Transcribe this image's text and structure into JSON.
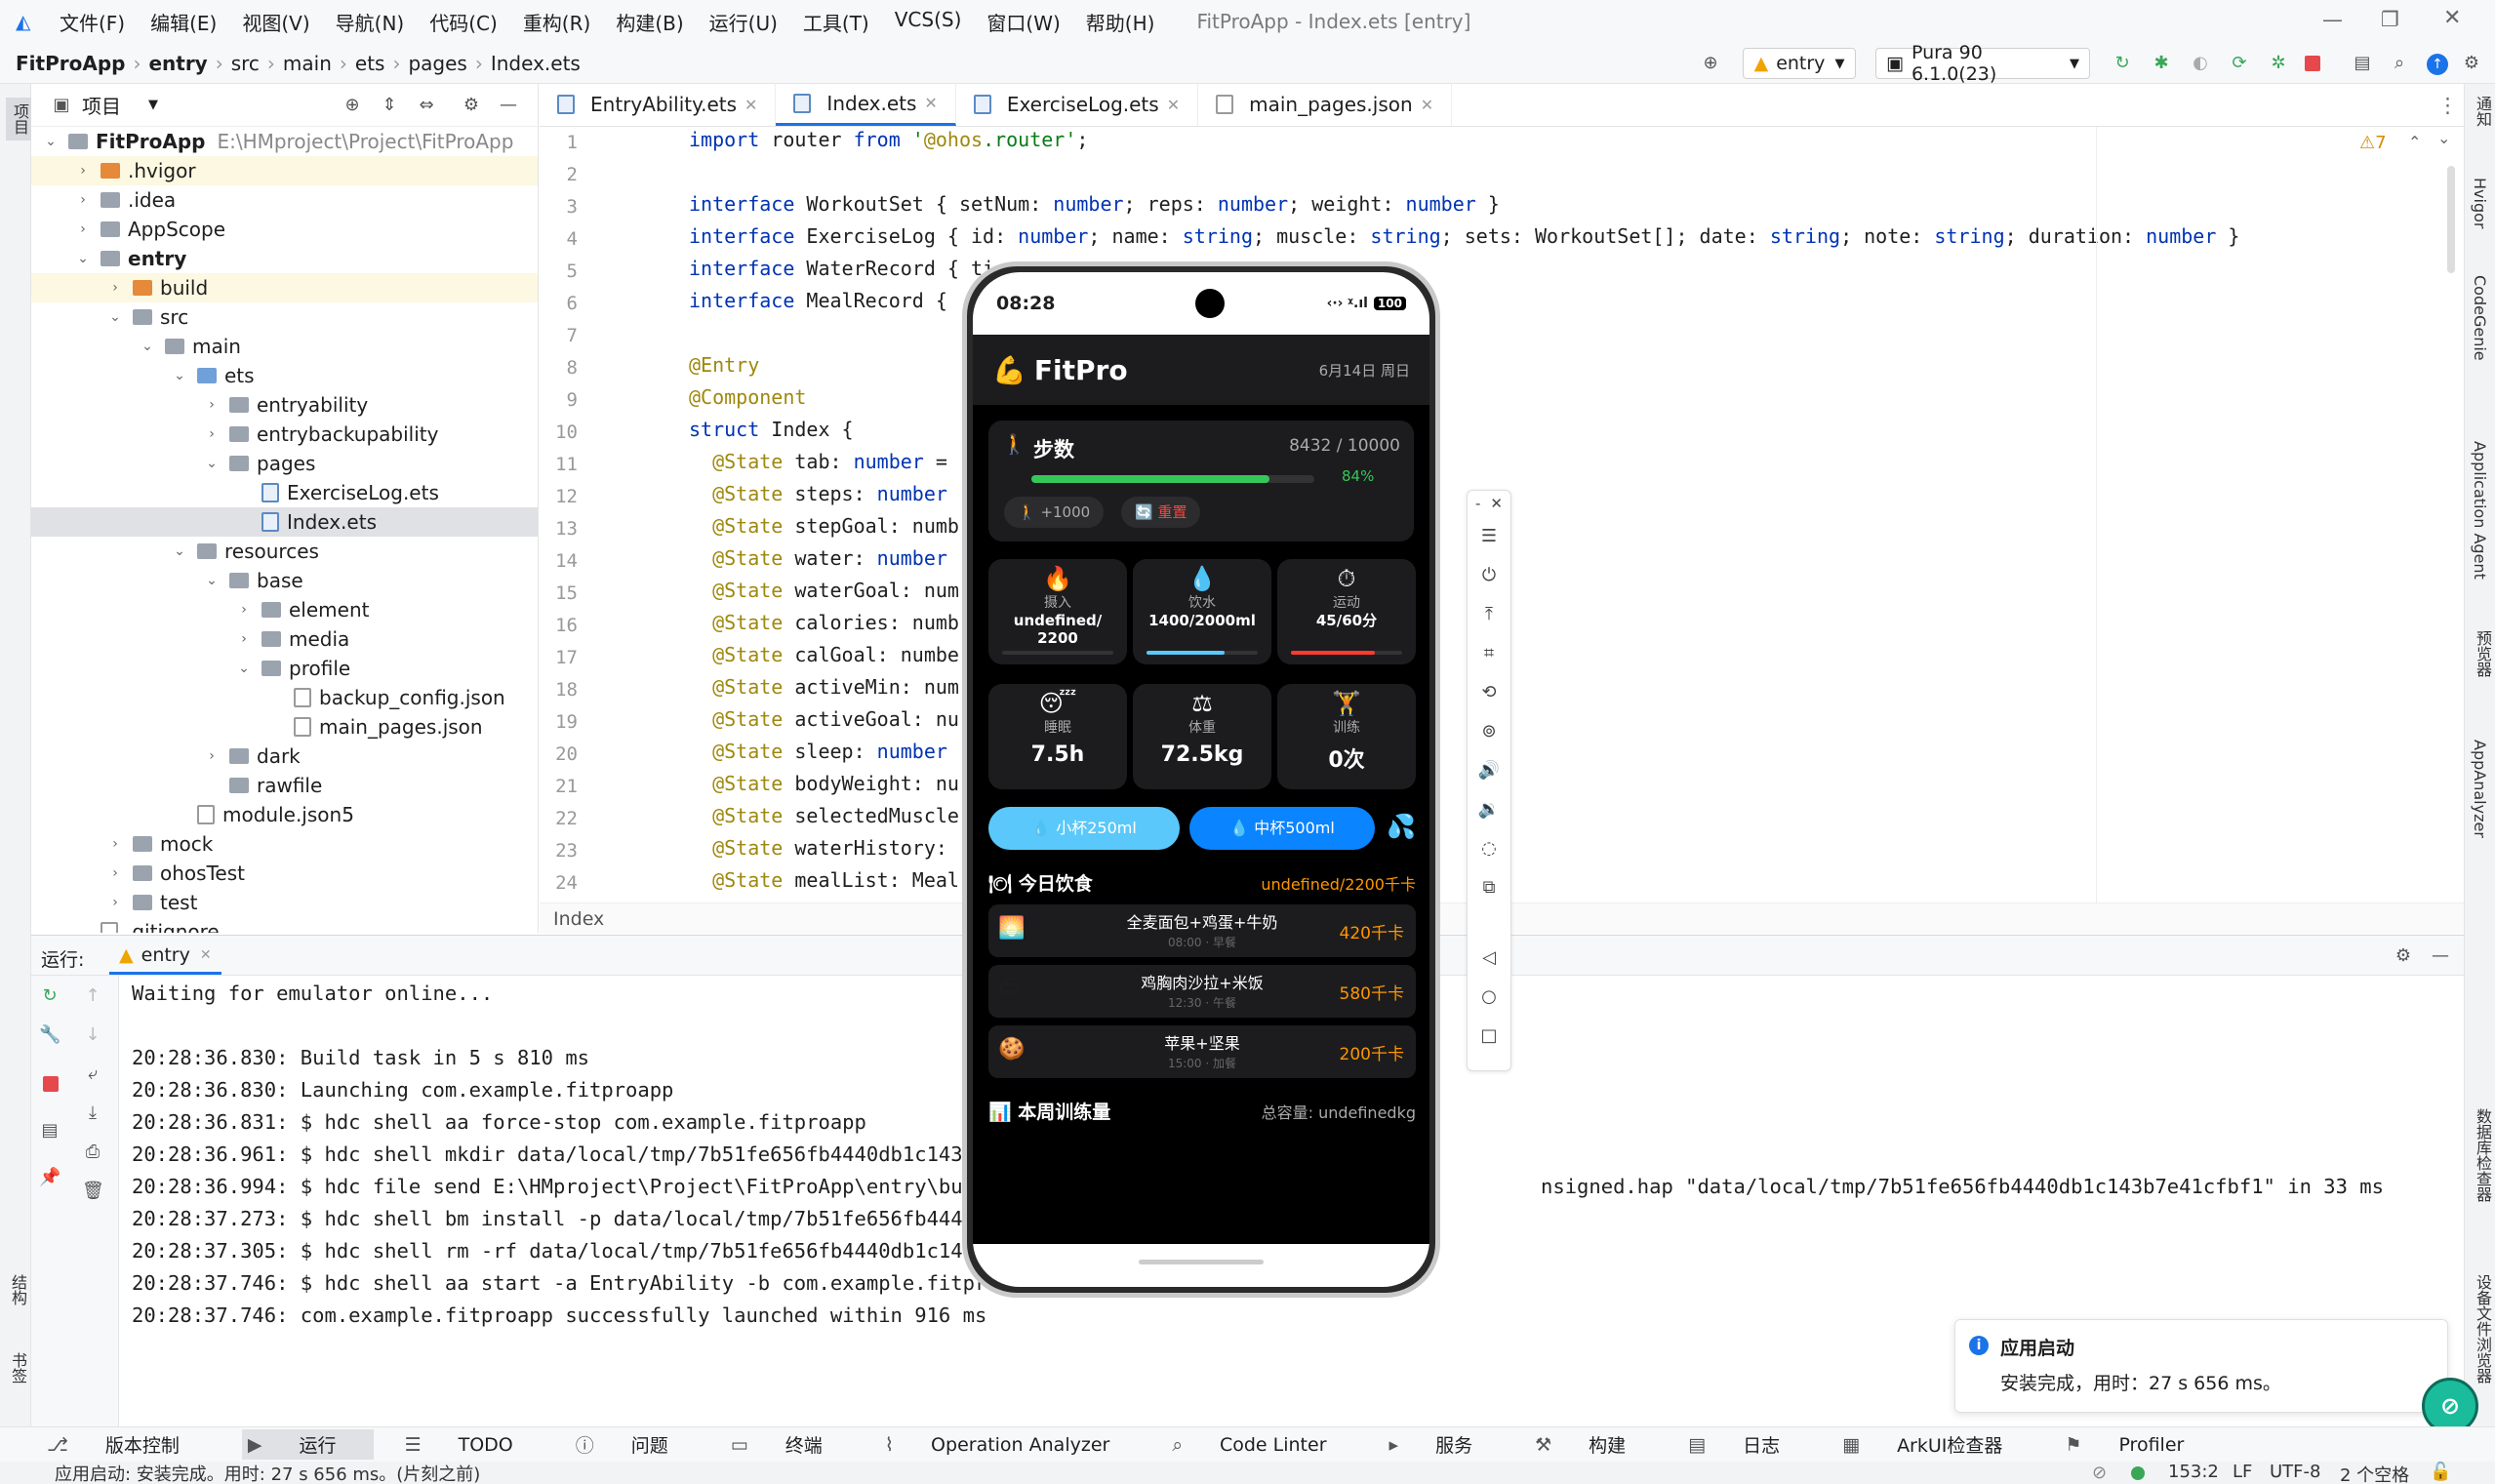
{
  "menu": [
    "文件(F)",
    "编辑(E)",
    "视图(V)",
    "导航(N)",
    "代码(C)",
    "重构(R)",
    "构建(B)",
    "运行(U)",
    "工具(T)",
    "VCS(S)",
    "窗口(W)",
    "帮助(H)"
  ],
  "window_title": "FitProApp - Index.ets [entry]",
  "breadcrumb": [
    "FitProApp",
    "entry",
    "src",
    "main",
    "ets",
    "pages",
    "Index.ets"
  ],
  "run_config": "entry",
  "device": "Pura 90 6.1.0(23)",
  "project_panel": {
    "title": "项目"
  },
  "tree": [
    {
      "depth": 0,
      "label": "FitProApp",
      "path": "E:\\HMproject\\Project\\FitProApp",
      "type": "root",
      "arrow": "v"
    },
    {
      "depth": 1,
      "label": ".hvigor",
      "type": "folder-orange",
      "arrow": ">",
      "hl": true
    },
    {
      "depth": 1,
      "label": ".idea",
      "type": "folder",
      "arrow": ">"
    },
    {
      "depth": 1,
      "label": "AppScope",
      "type": "folder",
      "arrow": ">"
    },
    {
      "depth": 1,
      "label": "entry",
      "type": "folder",
      "arrow": "v",
      "bold": true
    },
    {
      "depth": 2,
      "label": "build",
      "type": "folder-orange",
      "arrow": ">",
      "hl": true
    },
    {
      "depth": 2,
      "label": "src",
      "type": "folder",
      "arrow": "v"
    },
    {
      "depth": 3,
      "label": "main",
      "type": "folder",
      "arrow": "v"
    },
    {
      "depth": 4,
      "label": "ets",
      "type": "folder-blue",
      "arrow": "v"
    },
    {
      "depth": 5,
      "label": "entryability",
      "type": "folder",
      "arrow": ">"
    },
    {
      "depth": 5,
      "label": "entrybackupability",
      "type": "folder",
      "arrow": ">"
    },
    {
      "depth": 5,
      "label": "pages",
      "type": "folder",
      "arrow": "v"
    },
    {
      "depth": 6,
      "label": "ExerciseLog.ets",
      "type": "file",
      "arrow": ""
    },
    {
      "depth": 6,
      "label": "Index.ets",
      "type": "file",
      "arrow": "",
      "sel": true
    },
    {
      "depth": 4,
      "label": "resources",
      "type": "folder",
      "arrow": "v"
    },
    {
      "depth": 5,
      "label": "base",
      "type": "folder",
      "arrow": "v"
    },
    {
      "depth": 6,
      "label": "element",
      "type": "folder",
      "arrow": ">"
    },
    {
      "depth": 6,
      "label": "media",
      "type": "folder",
      "arrow": ">"
    },
    {
      "depth": 6,
      "label": "profile",
      "type": "folder",
      "arrow": "v"
    },
    {
      "depth": 7,
      "label": "backup_config.json",
      "type": "json",
      "arrow": ""
    },
    {
      "depth": 7,
      "label": "main_pages.json",
      "type": "json",
      "arrow": ""
    },
    {
      "depth": 5,
      "label": "dark",
      "type": "folder",
      "arrow": ">"
    },
    {
      "depth": 5,
      "label": "rawfile",
      "type": "folder",
      "arrow": ""
    },
    {
      "depth": 4,
      "label": "module.json5",
      "type": "json",
      "arrow": ""
    },
    {
      "depth": 2,
      "label": "mock",
      "type": "folder",
      "arrow": ">"
    },
    {
      "depth": 2,
      "label": "ohosTest",
      "type": "folder",
      "arrow": ">"
    },
    {
      "depth": 2,
      "label": "test",
      "type": "folder",
      "arrow": ">"
    },
    {
      "depth": 1,
      "label": ".gitignore",
      "type": "json",
      "arrow": ""
    }
  ],
  "tabs": [
    {
      "label": "EntryAbility.ets",
      "active": false
    },
    {
      "label": "Index.ets",
      "active": true
    },
    {
      "label": "ExerciseLog.ets",
      "active": false
    },
    {
      "label": "main_pages.json",
      "active": false
    }
  ],
  "warnings": "⚠7",
  "code_lines": [
    "import router from '@ohos.router';",
    "",
    "interface WorkoutSet { setNum: number; reps: number; weight: number }",
    "interface ExerciseLog { id: number; name: string; muscle: string; sets: WorkoutSet[]; date: string; note: string; duration: number }",
    "interface WaterRecord { ti",
    "interface MealRecord {                          type: string }",
    "",
    "@Entry",
    "@Component",
    "struct Index {",
    "  @State tab: number = ",
    "  @State steps: number",
    "  @State stepGoal: numb",
    "  @State water: number",
    "  @State waterGoal: num",
    "  @State calories: numb",
    "  @State calGoal: numbe",
    "  @State activeMin: num",
    "  @State activeGoal: nu",
    "  @State sleep: number ",
    "  @State bodyWeight: nu",
    "  @State selectedMuscle",
    "  @State waterHistory: ",
    "  @State mealList: Meal"
  ],
  "editor_crumb": "Index",
  "run_panel": {
    "label": "运行:",
    "config": "entry"
  },
  "console_lines": [
    "Waiting for emulator online...",
    "",
    "20:28:36.830: Build task in 5 s 810 ms",
    "20:28:36.830: Launching com.example.fitproapp",
    "20:28:36.831: $ hdc shell aa force-stop com.example.fitproapp",
    "20:28:36.961: $ hdc shell mkdir data/local/tmp/7b51fe656fb4440db1c143b7",
    "20:28:36.994: $ hdc file send E:\\HMproject\\Project\\FitProApp\\entry\\buil                                              nsigned.hap \"data/local/tmp/7b51fe656fb4440db1c143b7e41cfbf1\" in 33 ms",
    "20:28:37.273: $ hdc shell bm install -p data/local/tmp/7b51fe656fb4440c",
    "20:28:37.305: $ hdc shell rm -rf data/local/tmp/7b51fe656fb4440db1c143b",
    "20:28:37.746: $ hdc shell aa start -a EntryAbility -b com.example.fitpro",
    "20:28:37.746: com.example.fitproapp successfully launched within 916 ms"
  ],
  "bottom_tools": [
    "版本控制",
    "运行",
    "TODO",
    "问题",
    "终端",
    "Operation Analyzer",
    "Code Linter",
    "服务",
    "构建",
    "日志",
    "ArkUI检查器",
    "Profiler"
  ],
  "status": {
    "message": "应用启动: 安装完成。用时: 27 s 656 ms。(片刻之前)",
    "pos": "153:2",
    "eol": "LF",
    "enc": "UTF-8",
    "indent": "2 个空格"
  },
  "notification": {
    "title": "应用启动",
    "body": "安装完成，用时：27 s 656 ms。"
  },
  "left_strip": [
    "项目",
    "结构",
    "书签"
  ],
  "right_strip": [
    "通知",
    "Hvigor",
    "CodeGenie",
    "Application Agent",
    "预览器",
    "AppAnalyzer",
    "数据库检查器",
    "设备文件浏览器"
  ],
  "phone": {
    "time": "08:28",
    "battery": "100",
    "app_name": "FitPro",
    "app_icon": "💪",
    "date": "6月14日 周日",
    "steps": {
      "label": "步数",
      "icon": "🚶",
      "value": "8432 / 10000",
      "percent": "84%",
      "progress": 0.84,
      "add_btn": "🚶 +1000",
      "reset_btn": "🔄 重置"
    },
    "tiles_row1": [
      {
        "icon": "🔥",
        "label": "摄入",
        "value": "undefined/\n2200",
        "color": "#ff9500",
        "bar": 0
      },
      {
        "icon": "💧",
        "label": "饮水",
        "value": "1400/2000ml",
        "color": "#5ac8fa",
        "bar": 0.7
      },
      {
        "icon": "⏱",
        "label": "运动",
        "value": "45/60分",
        "color": "#ff3b30",
        "bar": 0.75
      }
    ],
    "tiles_row2": [
      {
        "icon": "😴",
        "label": "睡眠",
        "value": "7.5h"
      },
      {
        "icon": "⚖",
        "label": "体重",
        "value": "72.5kg"
      },
      {
        "icon": "🏋",
        "label": "训练",
        "value": "0次"
      }
    ],
    "water_btns": [
      "💧 小杯250ml",
      "💧 中杯500ml"
    ],
    "water_icon": "💦",
    "meals_title": "🍽 今日饮食",
    "meals_total": "undefined/2200千卡",
    "meals": [
      {
        "icon": "🌅",
        "name": "全麦面包+鸡蛋+牛奶",
        "time": "08:00 · 早餐",
        "kcal": "420千卡"
      },
      {
        "icon": "😊",
        "name": "鸡胸肉沙拉+米饭",
        "time": "12:30 · 午餐",
        "kcal": "580千卡"
      },
      {
        "icon": "🍪",
        "name": "苹果+坚果",
        "time": "15:00 · 加餐",
        "kcal": "200千卡"
      }
    ],
    "week_title": "📊 本周训练量",
    "week_total": "总容量: undefinedkg"
  }
}
